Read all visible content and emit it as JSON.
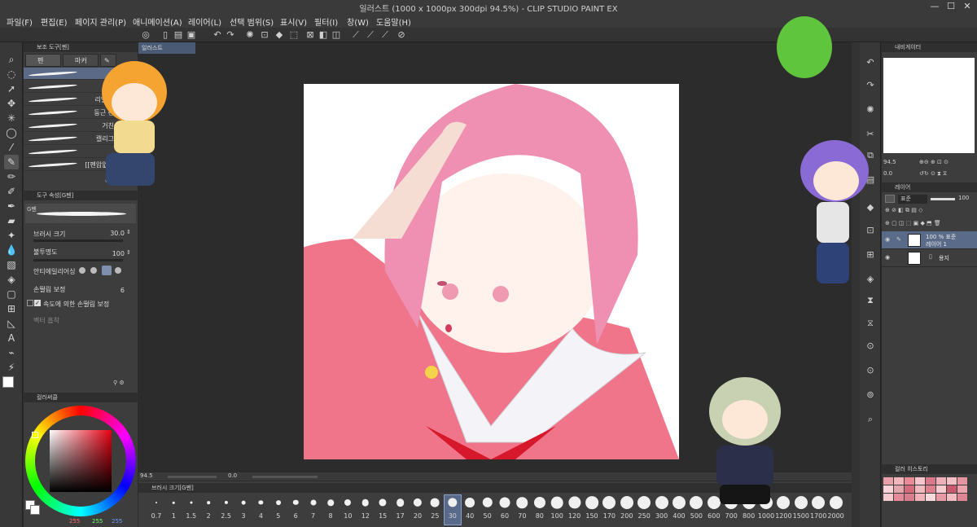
{
  "window": {
    "title": "일러스트 (1000 x 1000px 300dpi 94.5%)  - CLIP STUDIO PAINT EX",
    "minimize": "—",
    "maximize": "☐",
    "close": "✕"
  },
  "menu": [
    "파일(F)",
    "편집(E)",
    "페이지 관리(P)",
    "애니메이션(A)",
    "레이어(L)",
    "선택 범위(S)",
    "표시(V)",
    "필터(I)",
    "창(W)",
    "도움말(H)"
  ],
  "subtool": {
    "header": "보조 도구[펜]",
    "tabs": [
      "펜",
      "마커"
    ],
    "brushes": [
      {
        "name": ""
      },
      {
        "name": "스트"
      },
      {
        "name": "리얼 G"
      },
      {
        "name": "둥근 펜"
      },
      {
        "name": "거친"
      },
      {
        "name": "캘리그"
      },
      {
        "name": ""
      },
      {
        "name": "[[펜압없이"
      }
    ]
  },
  "tool_property": {
    "header": "도구 속성[G펜]",
    "preset_name": "G펜",
    "brush_size_label": "브러시 크기",
    "brush_size_value": "30.0",
    "opacity_label": "불투명도",
    "opacity_value": "100",
    "antialias_label": "안티에일리어싱",
    "stabilization_label": "손떨림 보정",
    "stabilization_value": "6",
    "speed_stabilization_label": "속도에 의한 손떨림 보정",
    "speed_checked": true,
    "vector_label": "벡터 흡착"
  },
  "color_panel": {
    "header": "컬러써클",
    "r": "255",
    "g": "255",
    "b": "255",
    "hue_color": "#e60012"
  },
  "canvas": {
    "tab_label": "일러스트",
    "zoom": "94.5",
    "nav_value": "0.0"
  },
  "brush_size_panel": {
    "header": "브러시 크기[G펜]",
    "sizes": [
      "0.7",
      "1",
      "1.5",
      "2",
      "2.5",
      "3",
      "4",
      "5",
      "6",
      "7",
      "8",
      "10",
      "12",
      "15",
      "17",
      "20",
      "25",
      "30",
      "40",
      "50",
      "60",
      "70",
      "80",
      "100",
      "120",
      "150",
      "170",
      "200",
      "250",
      "300",
      "400",
      "500",
      "600",
      "700",
      "800",
      "1000",
      "1200",
      "1500",
      "1700",
      "2000"
    ],
    "selected": "30"
  },
  "navigator": {
    "header": "내비게이터",
    "zoom": "94.5",
    "rotation": "0.0"
  },
  "layer_panel": {
    "header": "레이어",
    "blend_mode": "표준",
    "opacity": "100",
    "layers": [
      {
        "line1": "100 % 표준",
        "line2": "레이어 1",
        "selected": true
      },
      {
        "line1": "용지",
        "line2": "",
        "selected": false
      }
    ]
  },
  "history_panel": {
    "header": "컬러 히스토리",
    "swatches": [
      "#e9a0a8",
      "#f2b6bd",
      "#e98a96",
      "#f6c6cc",
      "#d9788a",
      "#eeb0b8",
      "#f4c0c6",
      "#e6949f",
      "#fbd3d8",
      "#e2a6ad",
      "#d46a7c",
      "#f0bac1",
      "#e07f8e",
      "#f8cbd1",
      "#c95a6e",
      "#eba3ad",
      "#f5c9ce",
      "#e48b99",
      "#d97d8d",
      "#f1b2ba",
      "#fad9dd",
      "#e89aa4",
      "#f3bcc3",
      "#dd8593"
    ]
  },
  "colors": {
    "accent_blue": "#5b6a86",
    "panel": "#3d3d3d",
    "canvas_bg": "#2c2c2c"
  }
}
